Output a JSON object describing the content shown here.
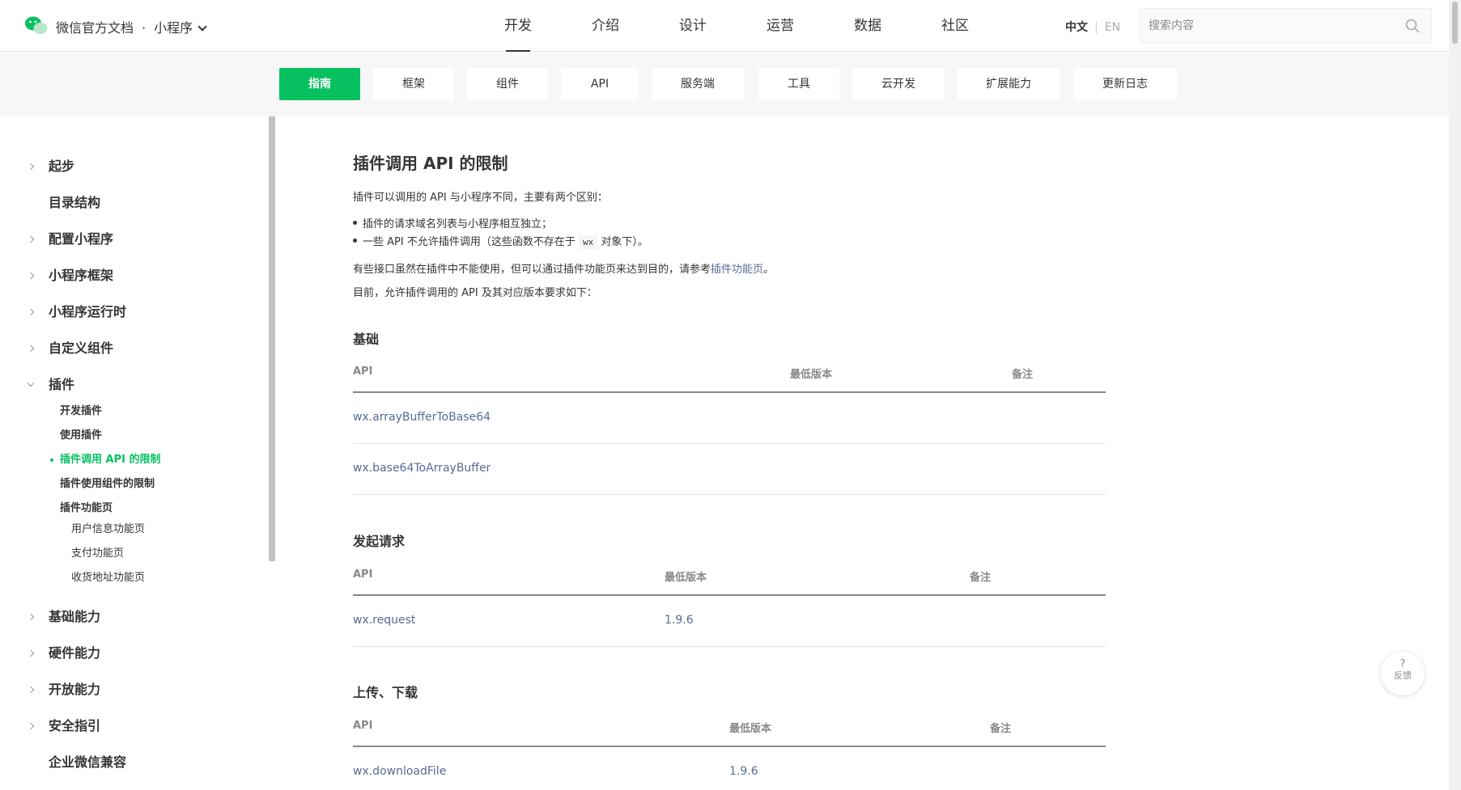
{
  "header": {
    "brand": "微信官方文档",
    "dot": "·",
    "product": "小程序",
    "nav": [
      "开发",
      "介绍",
      "设计",
      "运营",
      "数据",
      "社区"
    ],
    "lang_zh": "中文",
    "lang_sep": "|",
    "lang_en": "EN",
    "search_placeholder": "搜索内容"
  },
  "subnav": {
    "tabs": [
      "指南",
      "框架",
      "组件",
      "API",
      "服务端",
      "工具",
      "云开发",
      "扩展能力",
      "更新日志"
    ]
  },
  "sidebar": {
    "items": [
      "起步",
      "目录结构",
      "配置小程序",
      "小程序框架",
      "小程序运行时",
      "自定义组件",
      "插件",
      "基础能力",
      "硬件能力",
      "开放能力",
      "安全指引",
      "企业微信兼容"
    ],
    "plugin_children": [
      "开发插件",
      "使用插件",
      "插件调用 API 的限制",
      "插件使用组件的限制",
      "插件功能页"
    ],
    "feature_pages": [
      "用户信息功能页",
      "支付功能页",
      "收货地址功能页"
    ]
  },
  "content": {
    "title": "插件调用 API 的限制",
    "intro": "插件可以调用的 API 与小程序不同，主要有两个区别：",
    "bullet1": "插件的请求域名列表与小程序相互独立；",
    "bullet2_pre": "一些 API 不允许插件调用（这些函数不存在于",
    "bullet2_code": "wx",
    "bullet2_post": "对象下）。",
    "para2_pre": "有些接口虽然在插件中不能使用，但可以通过插件功能页来达到目的，请参考",
    "para2_link": "插件功能页",
    "para2_post": "。",
    "para3": "目前，允许插件调用的 API 及其对应版本要求如下：",
    "col_api": "API",
    "col_version": "最低版本",
    "col_note": "备注",
    "sections": [
      {
        "title": "基础",
        "rows": [
          {
            "api": "wx.arrayBufferToBase64",
            "version": "",
            "note": ""
          },
          {
            "api": "wx.base64ToArrayBuffer",
            "version": "",
            "note": ""
          }
        ]
      },
      {
        "title": "发起请求",
        "rows": [
          {
            "api": "wx.request",
            "version": "1.9.6",
            "note": ""
          }
        ]
      },
      {
        "title": "上传、下载",
        "rows": [
          {
            "api": "wx.downloadFile",
            "version": "1.9.6",
            "note": ""
          }
        ]
      }
    ]
  },
  "feedback": {
    "icon": "?",
    "label": "反馈"
  },
  "colors": {
    "accent": "#07c160",
    "link": "#576b95",
    "text": "#353535",
    "muted": "#888888"
  },
  "icons": {
    "logo": "wechat-logo-icon",
    "search": "search-icon",
    "chevron": "chevron-down-icon"
  }
}
